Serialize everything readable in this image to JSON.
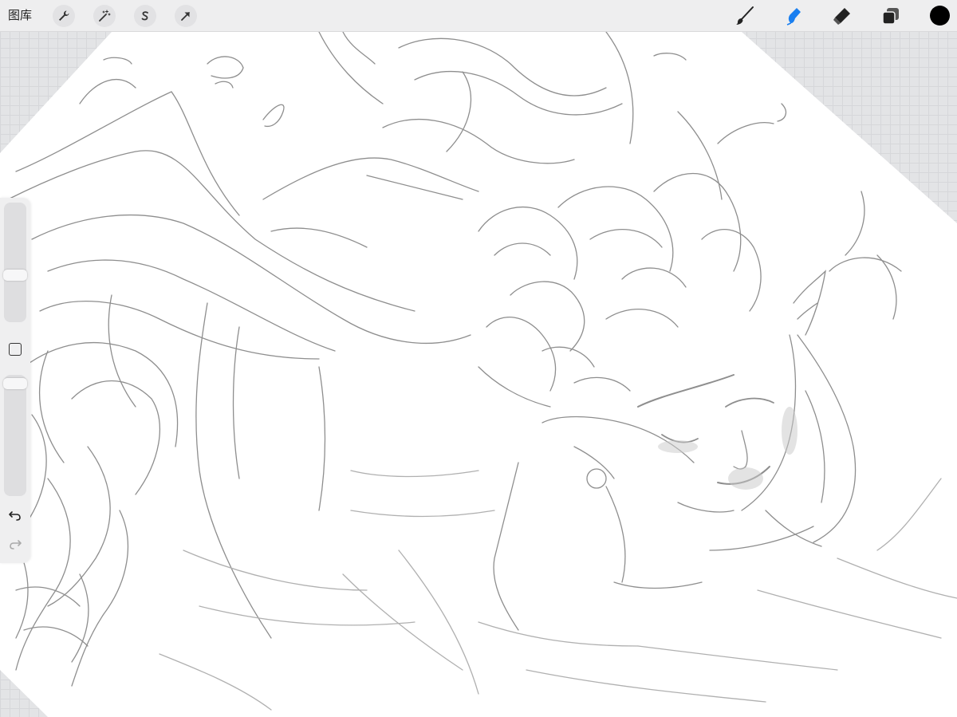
{
  "toolbar": {
    "gallery_label": "图库",
    "left_tools": [
      {
        "icon": "wrench-icon"
      },
      {
        "icon": "magic-wand-icon"
      },
      {
        "icon": "selection-s-icon"
      },
      {
        "icon": "arrow-move-icon"
      }
    ],
    "right_tools": [
      {
        "icon": "brush-icon"
      },
      {
        "icon": "smudge-icon",
        "active": true
      },
      {
        "icon": "eraser-icon"
      },
      {
        "icon": "layers-icon"
      }
    ],
    "active_color": "#000000",
    "active_tool_color": "#1a7ff0"
  },
  "sidebar": {
    "brush_size": 0.62,
    "brush_opacity": 0.05,
    "icons": [
      "modify-square-icon",
      "undo-icon",
      "redo-icon"
    ]
  },
  "canvas": {
    "background": "#ffffff",
    "sketch_color": "#8a8a8a"
  }
}
